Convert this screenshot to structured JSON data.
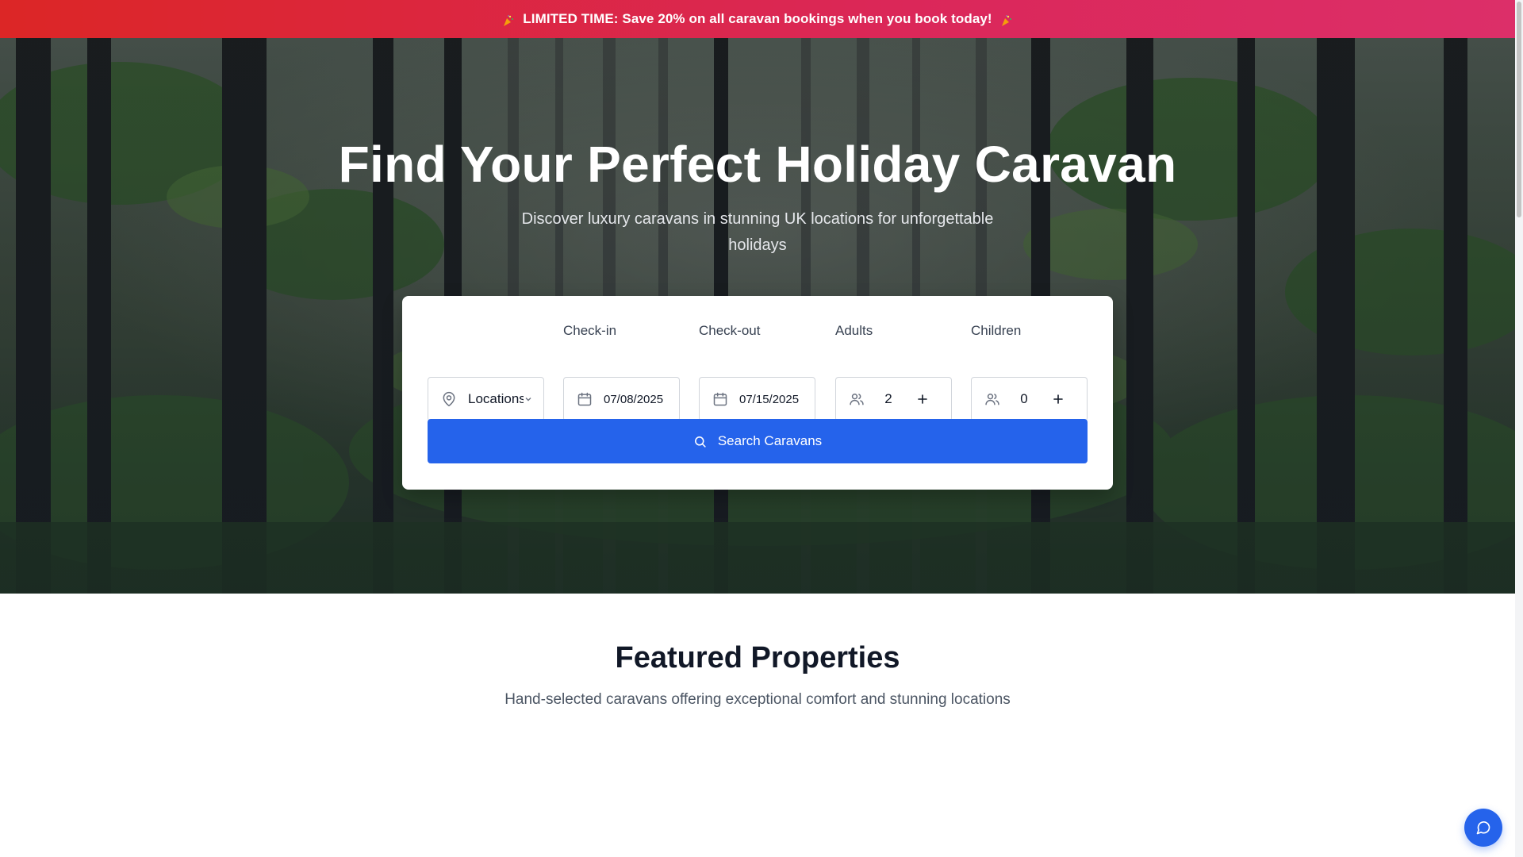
{
  "promo": {
    "text": "LIMITED TIME: Save 20% on all caravan bookings when you book today!",
    "left_icon": "party-popper-icon",
    "right_icon": "party-popper-icon"
  },
  "hero": {
    "title": "Find Your Perfect Holiday Caravan",
    "subtitle": "Discover luxury caravans in stunning UK locations for unforgettable holidays"
  },
  "search": {
    "location": {
      "label": "",
      "value": "Locations",
      "icon": "map-pin-icon"
    },
    "checkin": {
      "label": "Check-in",
      "value": "07/08/2025",
      "icon": "calendar-icon"
    },
    "checkout": {
      "label": "Check-out",
      "value": "07/15/2025",
      "icon": "calendar-icon"
    },
    "adults": {
      "label": "Adults",
      "value": "2",
      "icon": "users-icon"
    },
    "children": {
      "label": "Children",
      "value": "0",
      "icon": "users-icon"
    },
    "button_label": "Search Caravans",
    "button_icon": "search-icon"
  },
  "featured": {
    "title": "Featured Properties",
    "subtitle": "Hand-selected caravans offering exceptional comfort and stunning locations"
  },
  "chat": {
    "icon": "chat-bubble-icon"
  },
  "colors": {
    "primary": "#2563eb",
    "banner_start": "#dc2626",
    "banner_end": "#db2777",
    "heading": "#111827"
  }
}
